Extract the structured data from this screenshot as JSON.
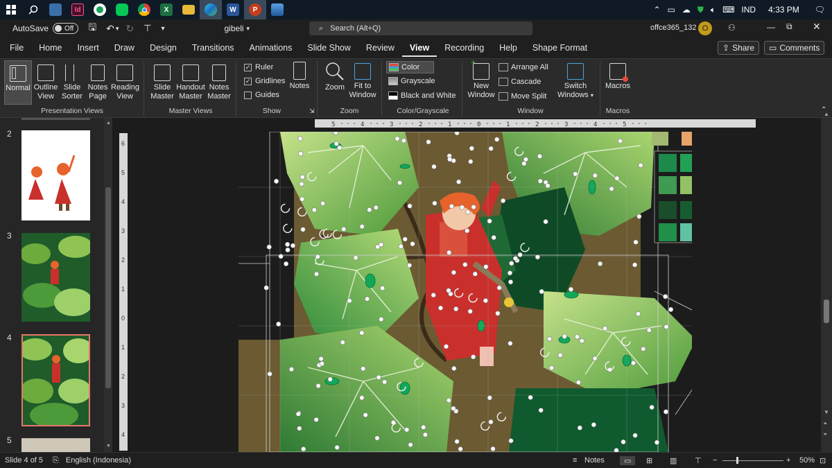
{
  "taskbar": {
    "apps": [
      {
        "icon": "windows-start-icon"
      },
      {
        "icon": "search-icon"
      },
      {
        "icon": "file-explorer-icon"
      },
      {
        "icon": "indesign-icon",
        "label": "Id"
      },
      {
        "icon": "photos-icon"
      },
      {
        "icon": "line-icon"
      },
      {
        "icon": "chrome-icon"
      },
      {
        "icon": "excel-icon",
        "label": "X"
      },
      {
        "icon": "folder-icon"
      },
      {
        "icon": "edge-icon"
      },
      {
        "icon": "word-icon",
        "label": "W"
      },
      {
        "icon": "powerpoint-icon",
        "label": "P"
      },
      {
        "icon": "photos-viewer-icon"
      }
    ],
    "language": "IND",
    "time": "4:33 PM"
  },
  "titlebar": {
    "autosave_label": "AutoSave",
    "autosave_state": "Off",
    "filename": "gibeli",
    "search_placeholder": "Search (Alt+Q)",
    "account": "offce365_132",
    "avatar_letter": "O"
  },
  "tabs": [
    "File",
    "Home",
    "Insert",
    "Draw",
    "Design",
    "Transitions",
    "Animations",
    "Slide Show",
    "Review",
    "View",
    "Recording",
    "Help",
    "Shape Format"
  ],
  "active_tab": "View",
  "share_label": "Share",
  "comments_label": "Comments",
  "ribbon": {
    "presentation_views": {
      "label": "Presentation Views",
      "buttons": [
        {
          "line1": "Normal",
          "line2": ""
        },
        {
          "line1": "Outline",
          "line2": "View"
        },
        {
          "line1": "Slide",
          "line2": "Sorter"
        },
        {
          "line1": "Notes",
          "line2": "Page"
        },
        {
          "line1": "Reading",
          "line2": "View"
        }
      ]
    },
    "master_views": {
      "label": "Master Views",
      "buttons": [
        {
          "line1": "Slide",
          "line2": "Master"
        },
        {
          "line1": "Handout",
          "line2": "Master"
        },
        {
          "line1": "Notes",
          "line2": "Master"
        }
      ]
    },
    "show": {
      "label": "Show",
      "ruler": "Ruler",
      "gridlines": "Gridlines",
      "guides": "Guides",
      "notes": "Notes"
    },
    "zoom": {
      "label": "Zoom",
      "zoom_btn": "Zoom",
      "fit_line1": "Fit to",
      "fit_line2": "Window"
    },
    "color": {
      "label": "Color/Grayscale",
      "color": "Color",
      "grayscale": "Grayscale",
      "bw": "Black and White"
    },
    "window": {
      "label": "Window",
      "new_line1": "New",
      "new_line2": "Window",
      "arrange": "Arrange All",
      "cascade": "Cascade",
      "move_split": "Move Split",
      "switch_line1": "Switch",
      "switch_line2": "Windows"
    },
    "macros": {
      "label": "Macros",
      "macros_btn": "Macros"
    }
  },
  "slides": [
    {
      "number": "2"
    },
    {
      "number": "3"
    },
    {
      "number": "4"
    },
    {
      "number": "5"
    }
  ],
  "ruler": {
    "h_ticks": [
      "5",
      "4",
      "3",
      "2",
      "1",
      "0",
      "1",
      "2",
      "3",
      "4",
      "5"
    ],
    "v_ticks": [
      "6",
      "5",
      "4",
      "3",
      "2",
      "1",
      "0",
      "1",
      "2",
      "3",
      "4"
    ]
  },
  "palette": {
    "top_row": [
      "#a3b870",
      "#e8a36a",
      "#e07a36",
      "#c8582e",
      "#a0452a"
    ],
    "grid": [
      "#1d8a4a",
      "#22a055",
      "#6db356",
      "#8cb94e",
      "#3f9a52",
      "#92c264",
      "#9ccf7e",
      "#1c6b34",
      "#1a4d2a",
      "#175c30",
      "#1f7a3e",
      "#24994c",
      "#1f8f4a",
      "#5fc2a0",
      "#59b06a",
      "#2ca44d"
    ]
  },
  "statusbar": {
    "slide_info": "Slide 4 of 5",
    "language": "English (Indonesia)",
    "notes": "Notes",
    "zoom": "50%"
  }
}
